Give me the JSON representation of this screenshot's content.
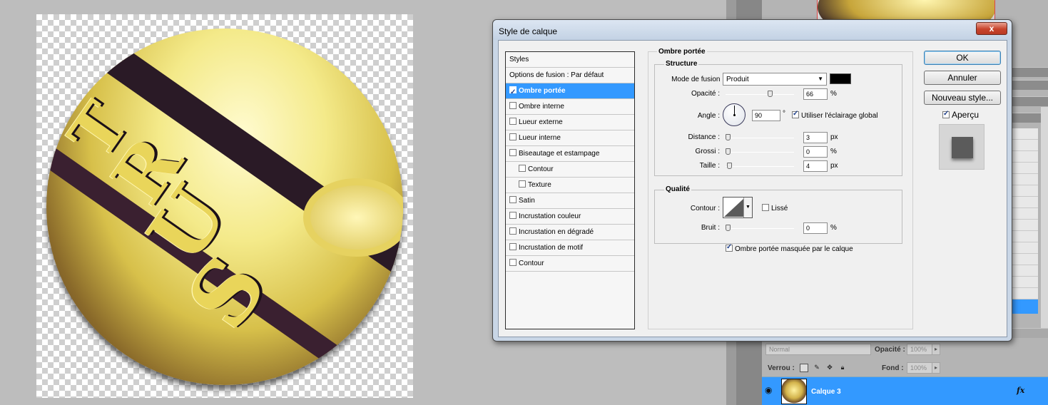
{
  "canvas": {},
  "layers_panel": {
    "blend_mode": "Normal",
    "opacity_label": "Opacité :",
    "opacity_value": "100%",
    "lock_label": "Verrou :",
    "fill_label": "Fond :",
    "fill_value": "100%",
    "layer_name": "Calque 3",
    "fx_label": "fx"
  },
  "dialog": {
    "title": "Style de calque",
    "close_label": "x",
    "styles_header": "Styles",
    "styles": [
      {
        "label": "Options de fusion : Par défaut",
        "checkbox": false,
        "checked": false,
        "indent": 0,
        "selected": false
      },
      {
        "label": "Ombre portée",
        "checkbox": true,
        "checked": true,
        "indent": 0,
        "selected": true
      },
      {
        "label": "Ombre interne",
        "checkbox": true,
        "checked": false,
        "indent": 0,
        "selected": false
      },
      {
        "label": "Lueur externe",
        "checkbox": true,
        "checked": false,
        "indent": 0,
        "selected": false
      },
      {
        "label": "Lueur interne",
        "checkbox": true,
        "checked": false,
        "indent": 0,
        "selected": false
      },
      {
        "label": "Biseautage et estampage",
        "checkbox": true,
        "checked": false,
        "indent": 0,
        "selected": false
      },
      {
        "label": "Contour",
        "checkbox": true,
        "checked": false,
        "indent": 1,
        "selected": false
      },
      {
        "label": "Texture",
        "checkbox": true,
        "checked": false,
        "indent": 1,
        "selected": false
      },
      {
        "label": "Satin",
        "checkbox": true,
        "checked": false,
        "indent": 0,
        "selected": false
      },
      {
        "label": "Incrustation couleur",
        "checkbox": true,
        "checked": false,
        "indent": 0,
        "selected": false
      },
      {
        "label": "Incrustation en dégradé",
        "checkbox": true,
        "checked": false,
        "indent": 0,
        "selected": false
      },
      {
        "label": "Incrustation de motif",
        "checkbox": true,
        "checked": false,
        "indent": 0,
        "selected": false
      },
      {
        "label": "Contour",
        "checkbox": true,
        "checked": false,
        "indent": 0,
        "selected": false
      }
    ],
    "section_title": "Ombre portée",
    "structure": {
      "title": "Structure",
      "blend_label": "Mode de fusion :",
      "blend_value": "Produit",
      "shadow_color": "#000000",
      "opacity_label": "Opacité :",
      "opacity_value": "66",
      "opacity_level": 0.66,
      "angle_label": "Angle :",
      "angle_value": "90",
      "angle_unit": "°",
      "global_light_label": "Utiliser l'éclairage global",
      "global_light_checked": true,
      "distance_label": "Distance :",
      "distance_value": "3",
      "distance_level": 0.0,
      "spread_label": "Grossi :",
      "spread_value": "0",
      "spread_level": 0.0,
      "size_label": "Taille :",
      "size_value": "4",
      "size_level": 0.02,
      "px": "px",
      "percent": "%"
    },
    "quality": {
      "title": "Qualité",
      "contour_label": "Contour :",
      "smooth_label": "Lissé",
      "smooth_checked": false,
      "noise_label": "Bruit :",
      "noise_value": "0",
      "noise_level": 0.0,
      "percent": "%"
    },
    "knockout_label": "Ombre portée masquée par le calque",
    "knockout_checked": true,
    "buttons": {
      "ok": "OK",
      "cancel": "Annuler",
      "new_style": "Nouveau style...",
      "preview_label": "Aperçu",
      "preview_checked": true
    }
  }
}
